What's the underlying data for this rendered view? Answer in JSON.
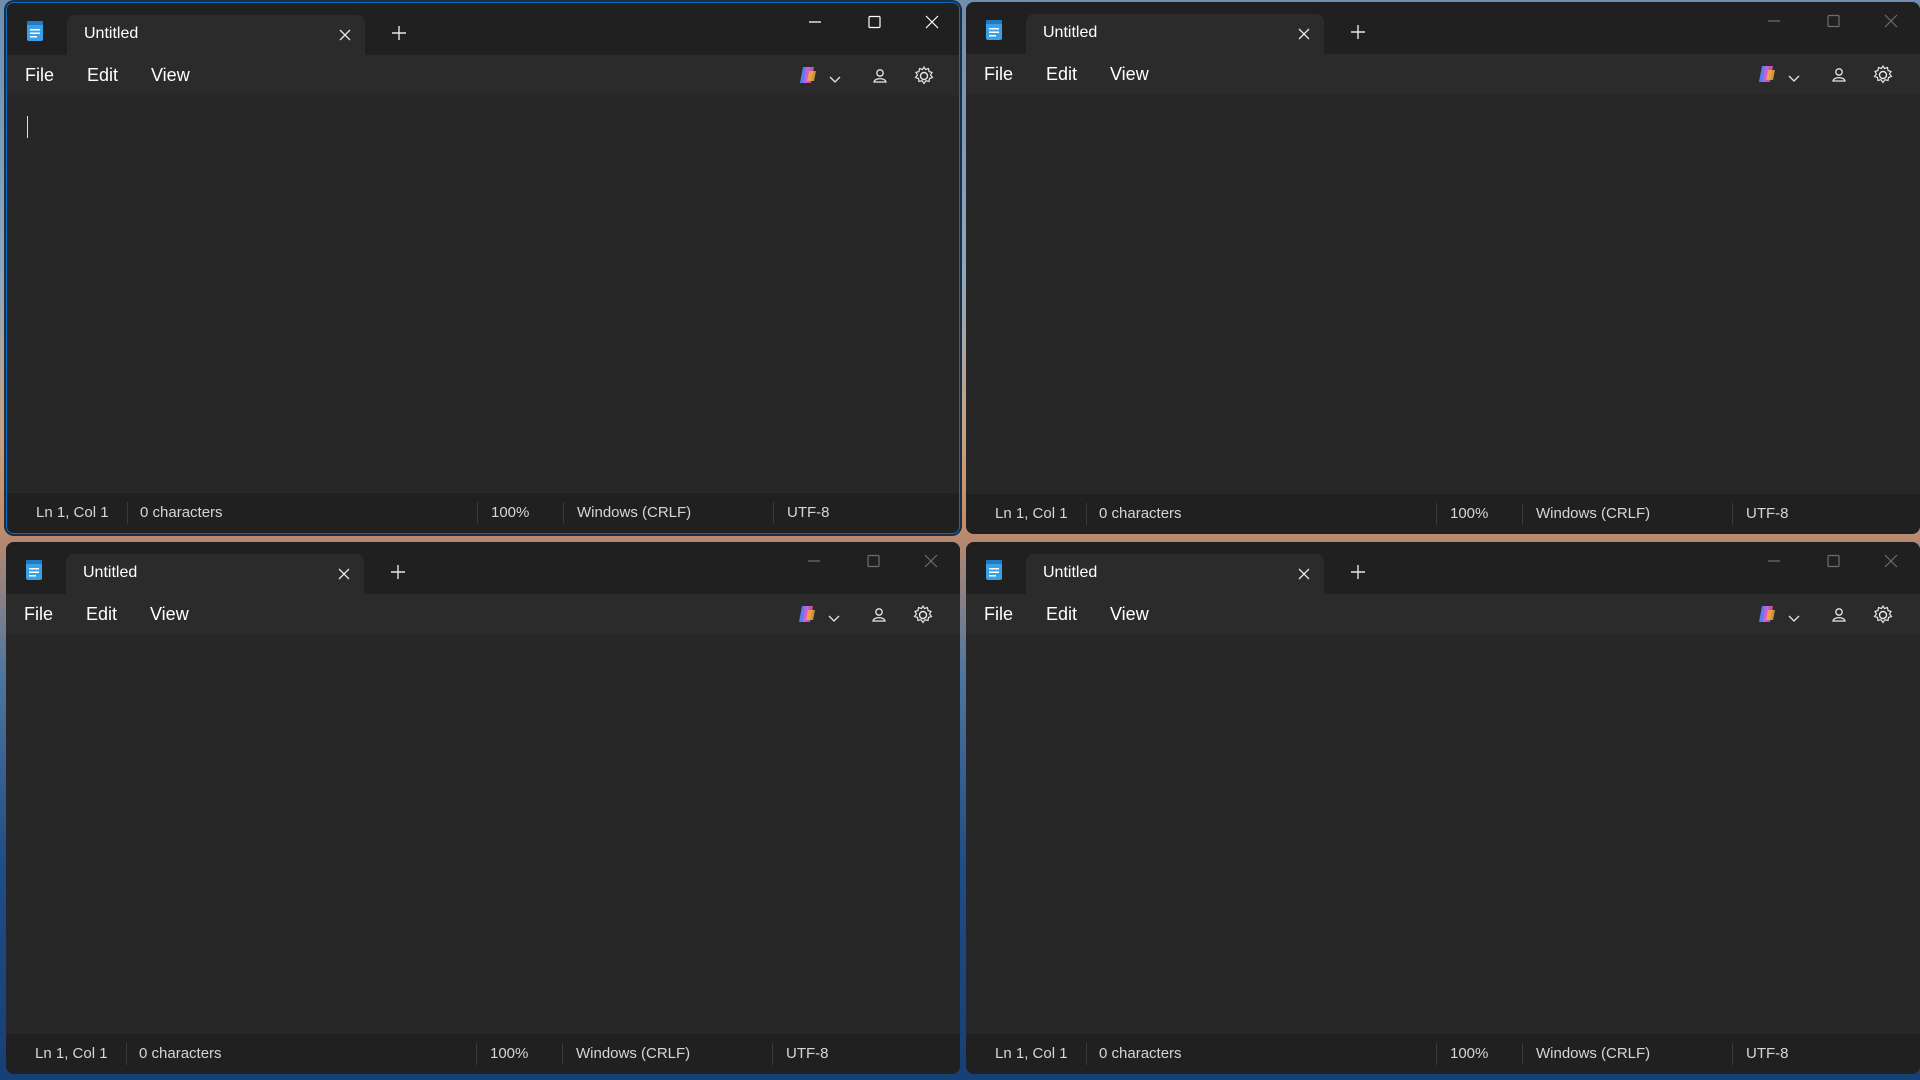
{
  "windows": [
    {
      "id": "top-left",
      "active": true,
      "tab_title": "Untitled",
      "menu": [
        "File",
        "Edit",
        "View"
      ],
      "status": {
        "position": "Ln 1, Col 1",
        "characters": "0 characters",
        "zoom": "100%",
        "line_ending": "Windows (CRLF)",
        "encoding": "UTF-8"
      }
    },
    {
      "id": "top-right",
      "active": false,
      "tab_title": "Untitled",
      "menu": [
        "File",
        "Edit",
        "View"
      ],
      "status": {
        "position": "Ln 1, Col 1",
        "characters": "0 characters",
        "zoom": "100%",
        "line_ending": "Windows (CRLF)",
        "encoding": "UTF-8"
      }
    },
    {
      "id": "bottom-left",
      "active": false,
      "tab_title": "Untitled",
      "menu": [
        "File",
        "Edit",
        "View"
      ],
      "status": {
        "position": "Ln 1, Col 1",
        "characters": "0 characters",
        "zoom": "100%",
        "line_ending": "Windows (CRLF)",
        "encoding": "UTF-8"
      }
    },
    {
      "id": "bottom-right",
      "active": false,
      "tab_title": "Untitled",
      "menu": [
        "File",
        "Edit",
        "View"
      ],
      "status": {
        "position": "Ln 1, Col 1",
        "characters": "0 characters",
        "zoom": "100%",
        "line_ending": "Windows (CRLF)",
        "encoding": "UTF-8"
      }
    }
  ],
  "icons": {
    "app": "notepad-icon",
    "tab_close": "close-icon",
    "new_tab": "plus-icon",
    "minimize": "minimize-icon",
    "maximize": "maximize-icon",
    "close": "close-icon",
    "copilot": "copilot-icon",
    "dropdown": "chevron-down-icon",
    "account": "account-icon",
    "settings": "gear-icon"
  },
  "colors": {
    "window_bg": "#272727",
    "titlebar_bg": "#202020",
    "accent_border": "#0f6cbd",
    "text": "#ffffff"
  }
}
